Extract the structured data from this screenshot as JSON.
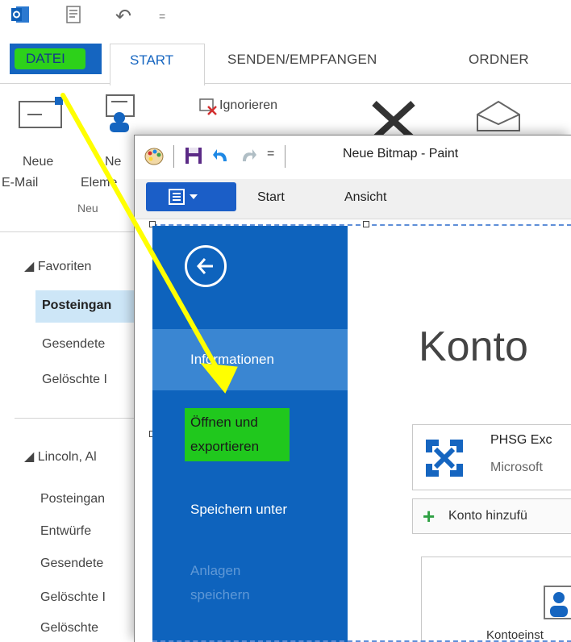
{
  "outlook": {
    "quick_access": {
      "undo_glyph": "↶",
      "dropdown_glyph": "="
    },
    "tabs": [
      {
        "label": "DATEI"
      },
      {
        "label": "START"
      },
      {
        "label": "SENDEN/EMPFANGEN"
      },
      {
        "label": "ORDNER"
      }
    ],
    "ribbon": {
      "new_email_line1": "Neue",
      "new_email_line2": "E-Mail",
      "new_items_line1": "Ne",
      "new_items_line2": "Eleme",
      "group_new": "Neu",
      "ignore": "Ignorieren"
    },
    "nav": {
      "favorites": "◢ Favoriten",
      "fav_items": [
        "Posteingan",
        "Gesendete",
        "Gelöschte I"
      ],
      "account": "◢ Lincoln, Al",
      "acc_items": [
        "Posteingan",
        "Entwürfe",
        "Gesendete",
        "Gelöschte I",
        "Gelöschte"
      ]
    }
  },
  "paint": {
    "title": "Neue Bitmap - Paint",
    "menu": {
      "start": "Start",
      "view": "Ansicht"
    },
    "backstage": {
      "info": "Informationen",
      "open_line1": "Öffnen und",
      "open_line2": "exportieren",
      "save_as": "Speichern unter",
      "attach_line1": "Anlagen",
      "attach_line2": "speichern"
    },
    "content": {
      "heading": "Konto",
      "account_name": "PHSG Exc",
      "account_sub": "Microsoft",
      "add_account": "Konto hinzufü",
      "account_settings": "Kontoeinst"
    }
  },
  "colors": {
    "accent_blue": "#1565c0",
    "backstage_blue": "#0e63bd",
    "highlight_green": "#2dd11a",
    "arrow_yellow": "#ffff00"
  }
}
